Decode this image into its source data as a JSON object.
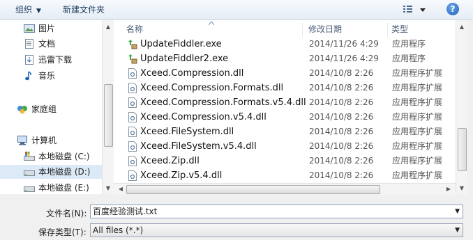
{
  "toolbar": {
    "organize_label": "组织",
    "new_folder_label": "新建文件夹",
    "help_label": "?"
  },
  "nav": {
    "items": [
      {
        "label": "图片",
        "icon": "pictures-icon"
      },
      {
        "label": "文档",
        "icon": "documents-icon"
      },
      {
        "label": "迅雷下载",
        "icon": "download-folder-icon"
      },
      {
        "label": "音乐",
        "icon": "music-icon"
      },
      {
        "label": "家庭组",
        "icon": "homegroup-icon"
      },
      {
        "label": "计算机",
        "icon": "computer-icon"
      },
      {
        "label": "本地磁盘 (C:)",
        "icon": "system-drive-icon"
      },
      {
        "label": "本地磁盘 (D:)",
        "icon": "drive-icon"
      },
      {
        "label": "本地磁盘 (E:)",
        "icon": "drive-icon"
      }
    ],
    "selected": "本地磁盘 (D:)"
  },
  "columns": {
    "name": "名称",
    "date": "修改日期",
    "type": "类型"
  },
  "files": [
    {
      "name": "UpdateFiddler.exe",
      "date": "2014/11/26 4:29",
      "type": "应用程序",
      "icon": "exe-icon"
    },
    {
      "name": "UpdateFiddler2.exe",
      "date": "2014/11/26 4:29",
      "type": "应用程序",
      "icon": "exe-icon"
    },
    {
      "name": "Xceed.Compression.dll",
      "date": "2014/10/8 2:26",
      "type": "应用程序扩展",
      "icon": "dll-icon"
    },
    {
      "name": "Xceed.Compression.Formats.dll",
      "date": "2014/10/8 2:26",
      "type": "应用程序扩展",
      "icon": "dll-icon"
    },
    {
      "name": "Xceed.Compression.Formats.v5.4.dll",
      "date": "2014/10/8 2:26",
      "type": "应用程序扩展",
      "icon": "dll-icon"
    },
    {
      "name": "Xceed.Compression.v5.4.dll",
      "date": "2014/10/8 2:26",
      "type": "应用程序扩展",
      "icon": "dll-icon"
    },
    {
      "name": "Xceed.FileSystem.dll",
      "date": "2014/10/8 2:26",
      "type": "应用程序扩展",
      "icon": "dll-icon"
    },
    {
      "name": "Xceed.FileSystem.v5.4.dll",
      "date": "2014/10/8 2:26",
      "type": "应用程序扩展",
      "icon": "dll-icon"
    },
    {
      "name": "Xceed.Zip.dll",
      "date": "2014/10/8 2:26",
      "type": "应用程序扩展",
      "icon": "dll-icon"
    },
    {
      "name": "Xceed.Zip.v5.4.dll",
      "date": "2014/10/8 2:26",
      "type": "应用程序扩展",
      "icon": "dll-icon"
    }
  ],
  "form": {
    "filename_label": "文件名(N):",
    "filename_value": "百度经验测试.txt",
    "filetype_label": "保存类型(T):",
    "filetype_value": "All files (*.*)"
  },
  "colors": {
    "selection": "#dce9f7",
    "header_text": "#4c607a",
    "toolbar_text": "#1e3a5f"
  }
}
